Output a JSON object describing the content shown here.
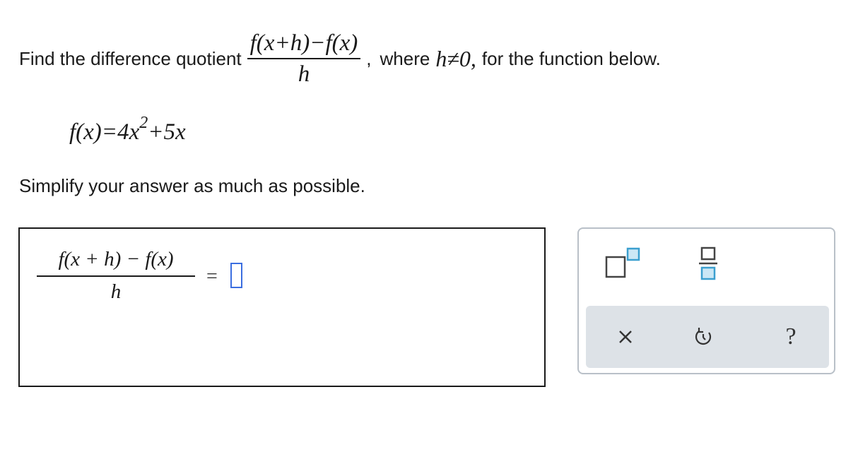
{
  "prompt": {
    "lead_text": "Find the difference quotient",
    "quotient_numerator": "f(x+h)−f(x)",
    "quotient_denominator": "h",
    "comma": ",",
    "where_text": "where",
    "condition": "h≠0,",
    "tail_text": "for the function below."
  },
  "function_def": {
    "lhs": "f(x)=4x",
    "exponent": "2",
    "rhs": "+5x"
  },
  "instruction": "Simplify your answer as much as possible.",
  "answer": {
    "numerator": "f(x + h) − f(x)",
    "denominator": "h",
    "equals": "=",
    "input_value": ""
  },
  "palette": {
    "tools": [
      "exponent-template",
      "fraction-template"
    ],
    "actions": [
      "clear",
      "undo",
      "help"
    ],
    "help_symbol": "?",
    "accent_color": "#3b9fcf",
    "action_bar_color": "#dde2e7"
  }
}
